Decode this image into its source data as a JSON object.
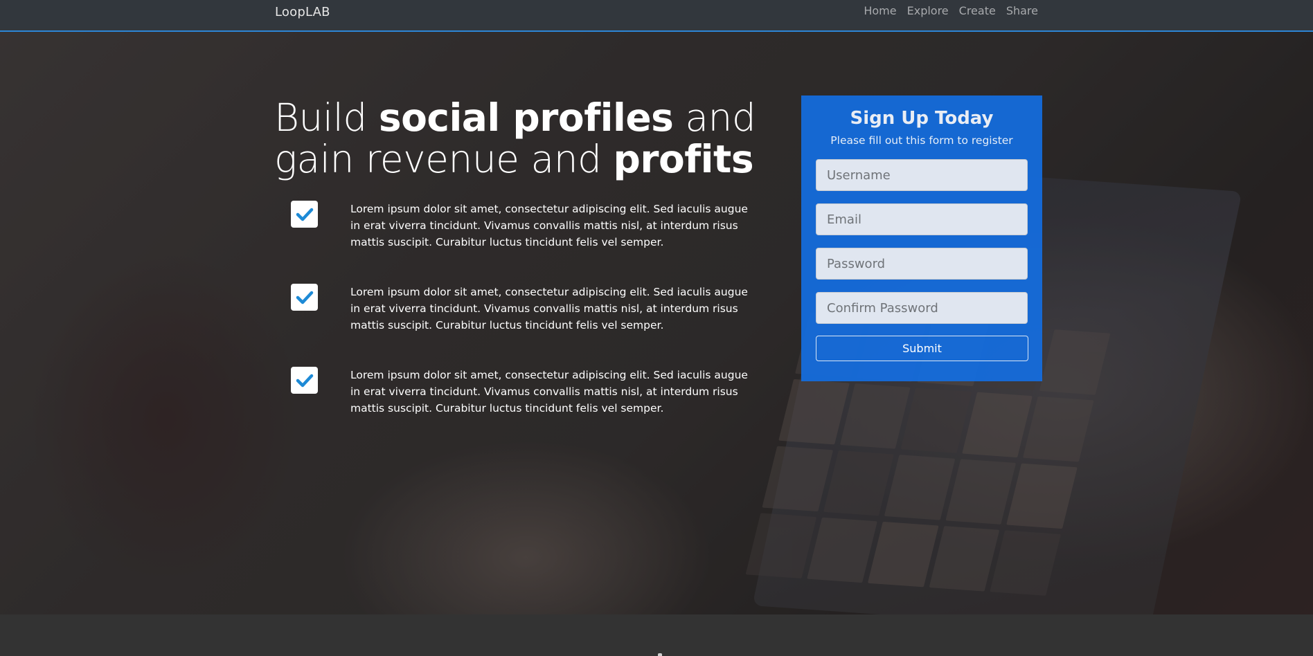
{
  "navbar": {
    "brand": "LoopLAB",
    "links": [
      "Home",
      "Explore",
      "Create",
      "Share"
    ],
    "accent_color": "#2d86d6"
  },
  "hero": {
    "headline": {
      "part1": "Build ",
      "bold1": "social profiles",
      "part2": " and gain revenue and ",
      "bold2": "profits"
    },
    "features": [
      {
        "icon": "check-icon",
        "text": "Lorem ipsum dolor sit amet, consectetur adipiscing elit. Sed iaculis augue in erat viverra tincidunt. Vivamus convallis mattis nisl, at interdum risus mattis suscipit. Curabitur luctus tincidunt felis vel semper."
      },
      {
        "icon": "check-icon",
        "text": "Lorem ipsum dolor sit amet, consectetur adipiscing elit. Sed iaculis augue in erat viverra tincidunt. Vivamus convallis mattis nisl, at interdum risus mattis suscipit. Curabitur luctus tincidunt felis vel semper."
      },
      {
        "icon": "check-icon",
        "text": "Lorem ipsum dolor sit amet, consectetur adipiscing elit. Sed iaculis augue in erat viverra tincidunt. Vivamus convallis mattis nisl, at interdum risus mattis suscipit. Curabitur luctus tincidunt felis vel semper."
      }
    ]
  },
  "signup": {
    "title": "Sign Up Today",
    "subtitle": "Please fill out this form to register",
    "fields": {
      "username_placeholder": "Username",
      "email_placeholder": "Email",
      "password_placeholder": "Password",
      "confirm_placeholder": "Confirm Password"
    },
    "submit_label": "Submit",
    "panel_color": "#146ee1"
  },
  "colors": {
    "check_color": "#1d8ad6"
  }
}
